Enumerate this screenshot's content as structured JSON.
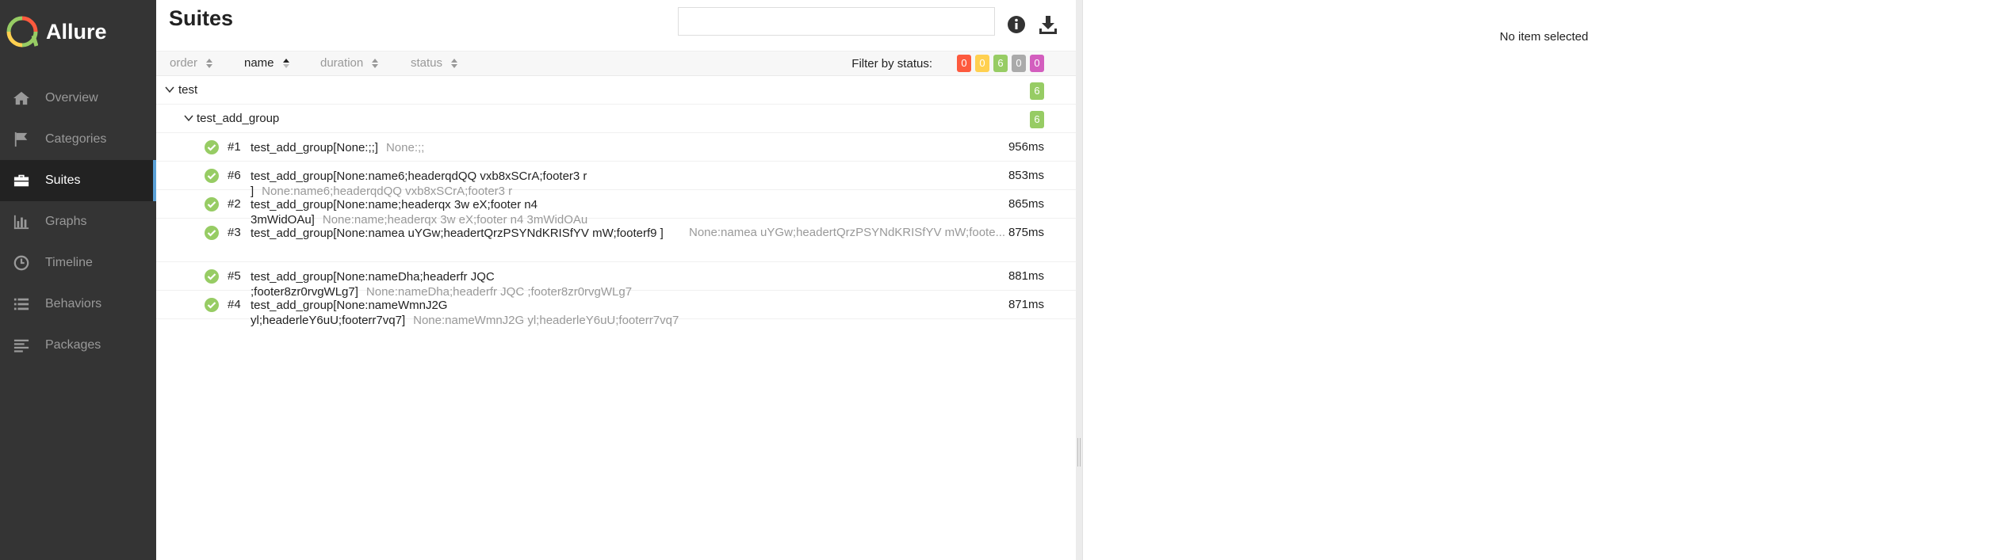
{
  "brand": {
    "name": "Allure"
  },
  "sidebar": {
    "items": [
      {
        "label": "Overview",
        "icon": "home-icon",
        "active": false
      },
      {
        "label": "Categories",
        "icon": "flag-icon",
        "active": false
      },
      {
        "label": "Suites",
        "icon": "briefcase-icon",
        "active": true
      },
      {
        "label": "Graphs",
        "icon": "bar-chart-icon",
        "active": false
      },
      {
        "label": "Timeline",
        "icon": "clock-icon",
        "active": false
      },
      {
        "label": "Behaviors",
        "icon": "list-icon",
        "active": false
      },
      {
        "label": "Packages",
        "icon": "align-left-icon",
        "active": false
      }
    ]
  },
  "main": {
    "title": "Suites",
    "search": {
      "value": "",
      "placeholder": ""
    },
    "sort": {
      "order": "order",
      "name": "name",
      "duration": "duration",
      "status": "status"
    },
    "filter": {
      "label": "Filter by status:",
      "badges": [
        {
          "status": "failed",
          "count": "0",
          "color": "#fd5a3e"
        },
        {
          "status": "broken",
          "count": "0",
          "color": "#ffd050"
        },
        {
          "status": "passed",
          "count": "6",
          "color": "#97cc64"
        },
        {
          "status": "skipped",
          "count": "0",
          "color": "#aaaaaa"
        },
        {
          "status": "unknown",
          "count": "0",
          "color": "#d35ebe"
        }
      ]
    },
    "tree": {
      "suite": {
        "name": "test",
        "count": "6"
      },
      "subsuite": {
        "name": "test_add_group",
        "count": "6"
      },
      "tests": [
        {
          "order": "#1",
          "name": "test_add_group[None:;;]",
          "params": "None:;;",
          "duration": "956ms"
        },
        {
          "order": "#6",
          "name": "test_add_group[None:name6;headerqdQQ vxb8xSCrA;footer3 r ]",
          "params": "None:name6;headerqdQQ vxb8xSCrA;footer3 r",
          "duration": "853ms"
        },
        {
          "order": "#2",
          "name": "test_add_group[None:name;headerqx 3w eX;footer n4 3mWidOAu]",
          "params": "None:name;headerqx 3w eX;footer n4 3mWidOAu",
          "duration": "865ms"
        },
        {
          "order": "#3",
          "name": "test_add_group[None:namea uYGw;headertQrzPSYNdKRISfYV mW;footerf9 ]",
          "params": "None:namea uYGw;headertQrzPSYNdKRISfYV mW;foote...",
          "duration": "875ms"
        },
        {
          "order": "#5",
          "name": "test_add_group[None:nameDha;headerfr JQC ;footer8zr0rvgWLg7]",
          "params": "None:nameDha;headerfr JQC ;footer8zr0rvgWLg7",
          "duration": "881ms"
        },
        {
          "order": "#4",
          "name": "test_add_group[None:nameWmnJ2G yl;headerleY6uU;footerr7vq7]",
          "params": "None:nameWmnJ2G yl;headerleY6uU;footerr7vq7",
          "duration": "871ms"
        }
      ]
    }
  },
  "detail": {
    "empty_text": "No item selected"
  }
}
